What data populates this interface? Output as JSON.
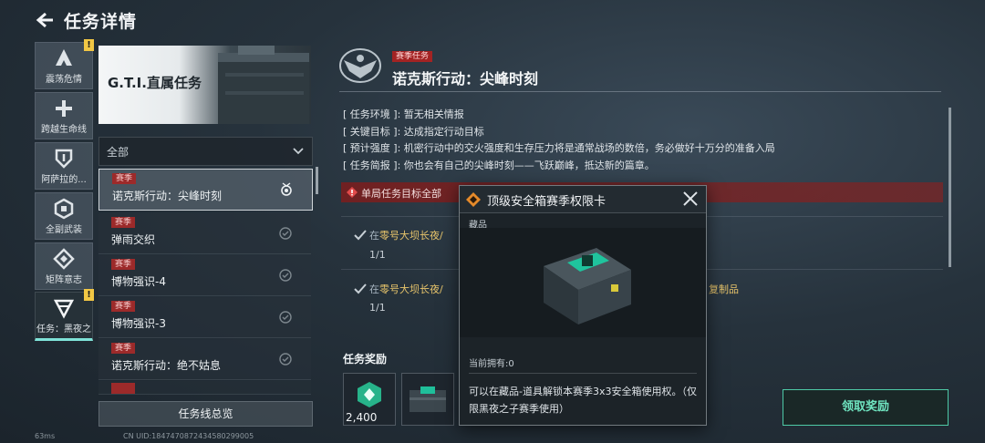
{
  "header": {
    "title": "任务详情",
    "back_icon": "back-arrow-icon"
  },
  "nav": {
    "items": [
      {
        "label": "震荡危情",
        "icon": "a-shield-icon",
        "warning": "!"
      },
      {
        "label": "跨越生命线",
        "icon": "plus-icon",
        "warning": ""
      },
      {
        "label": "阿萨拉的...",
        "icon": "shield-icon",
        "warning": ""
      },
      {
        "label": "全副武装",
        "icon": "hex-icon",
        "warning": ""
      },
      {
        "label": "矩阵意志",
        "icon": "diamond-icon",
        "warning": ""
      },
      {
        "label": "任务：黑夜之",
        "icon": "chevron-shield-icon",
        "warning": "!"
      }
    ]
  },
  "list": {
    "banner_title": "G.T.I.直属任务",
    "filter_label": "全部",
    "missions": [
      {
        "tag": "赛季",
        "name": "诺克斯行动：尖峰时刻"
      },
      {
        "tag": "赛季",
        "name": "弹雨交织"
      },
      {
        "tag": "赛季",
        "name": "博物强识-4"
      },
      {
        "tag": "赛季",
        "name": "博物强识-3"
      },
      {
        "tag": "赛季",
        "name": "诺克斯行动：绝不姑息"
      }
    ],
    "overview_button": "任务线总览"
  },
  "status_bar": {
    "ping": "63ms",
    "uid": "CN UID:1847470872434580299005"
  },
  "detail": {
    "season_tag": "赛季任务",
    "title": "诺克斯行动：尖峰时刻",
    "info": [
      {
        "key": "[ 任务环境 ]",
        "value": "暂无相关情报"
      },
      {
        "key": "[ 关键目标 ]",
        "value": "达成指定行动目标"
      },
      {
        "key": "[ 预计强度 ]",
        "value": "机密行动中的交火强度和生存压力将是通常战场的数倍，务必做好十万分的准备入局"
      },
      {
        "key": "[ 任务简报 ]",
        "value": "你也会有自己的尖峰时刻——飞跃巅峰，抵达新的篇章。"
      }
    ],
    "alert_text": "单局任务目标全部",
    "objectives": [
      {
        "prefix": "在",
        "highlight": "零号大坝长夜/",
        "progress": "1/1"
      },
      {
        "prefix": "在",
        "highlight": "零号大坝长夜/",
        "progress": "1/1"
      }
    ],
    "copy_link": "复制品",
    "reward_title": "任务奖励",
    "reward_count": "2,400",
    "claim_button": "领取奖励",
    "colors": {
      "accent": "#6fe4c0",
      "alert": "#7a1e1e",
      "highlight": "#e7c46b",
      "tag": "#a32323"
    }
  },
  "popup": {
    "title": "顶级安全箱赛季权限卡",
    "category": "藏品",
    "owned": "当前拥有:0",
    "description": "可以在藏品-道具解锁本赛季3x3安全箱使用权。（仅限黑夜之子赛季使用）"
  }
}
